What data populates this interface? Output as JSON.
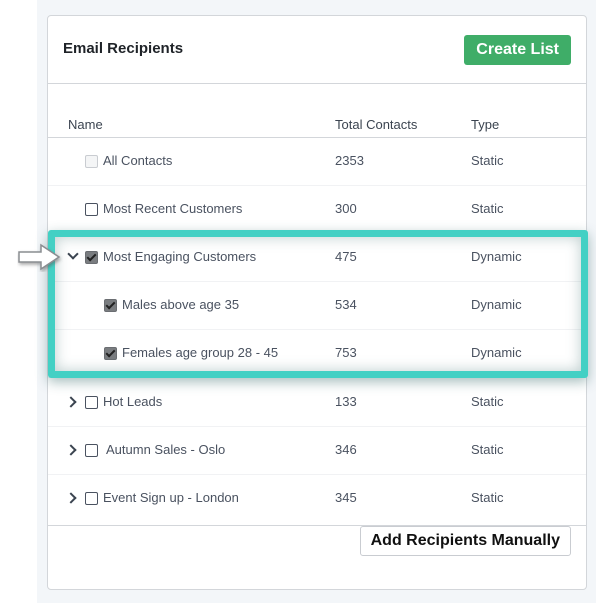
{
  "card": {
    "title": "Email Recipients",
    "create_list_label": "Create List",
    "add_manually_label": "Add Recipients Manually"
  },
  "table": {
    "headers": {
      "name": "Name",
      "total": "Total Contacts",
      "type": "Type"
    },
    "rows": [
      {
        "name": "All Contacts",
        "total": "2353",
        "type": "Static",
        "checkbox": "disabled",
        "expander": "none",
        "indent": 0
      },
      {
        "name": "Most Recent Customers",
        "total": "300",
        "type": "Static",
        "checkbox": "unchecked",
        "expander": "none",
        "indent": 0
      },
      {
        "name": "Most Engaging Customers",
        "total": "475",
        "type": "Dynamic",
        "checkbox": "checked",
        "expander": "expanded",
        "indent": 0
      },
      {
        "name": "Males above age 35",
        "total": "534",
        "type": "Dynamic",
        "checkbox": "checked",
        "expander": "none",
        "indent": 1
      },
      {
        "name": "Females age group 28 - 45",
        "total": "753",
        "type": "Dynamic",
        "checkbox": "checked",
        "expander": "none",
        "indent": 1
      },
      {
        "name": "Hot Leads",
        "total": "133",
        "type": "Static",
        "checkbox": "unchecked",
        "expander": "collapsed",
        "indent": 0
      },
      {
        "name": "Autumn Sales - Oslo",
        "total": "346",
        "type": "Static",
        "checkbox": "unchecked",
        "expander": "collapsed",
        "indent": 0
      },
      {
        "name": "Event Sign up - London",
        "total": "345",
        "type": "Static",
        "checkbox": "unchecked",
        "expander": "collapsed",
        "indent": 0
      }
    ]
  },
  "colors": {
    "create_button": "#3fad68",
    "highlight": "#43d0c4"
  }
}
